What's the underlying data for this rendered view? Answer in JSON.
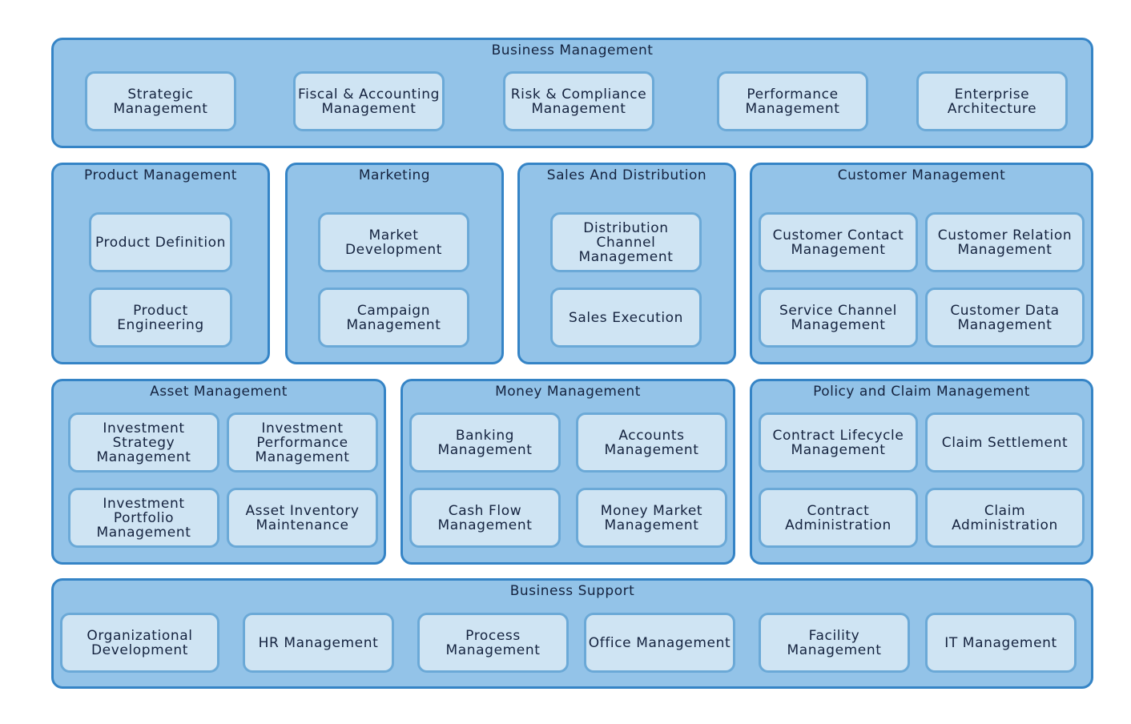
{
  "colors": {
    "group_fill": "#93c3e8",
    "group_border": "#3584c6",
    "capability_fill": "#cfe4f3",
    "capability_border": "#6ba9d7",
    "text": "#15233f"
  },
  "groups": [
    {
      "id": "business-management",
      "title": "Business Management",
      "capabilities": [
        "Strategic\nManagement",
        "Fiscal & Accounting\nManagement",
        "Risk & Compliance\nManagement",
        "Performance\nManagement",
        "Enterprise\nArchitecture"
      ]
    },
    {
      "id": "product-management",
      "title": "Product Management",
      "capabilities": [
        "Product Definition",
        "Product\nEngineering"
      ]
    },
    {
      "id": "marketing",
      "title": "Marketing",
      "capabilities": [
        "Market\nDevelopment",
        "Campaign\nManagement"
      ]
    },
    {
      "id": "sales-and-distribution",
      "title": "Sales And Distribution",
      "capabilities": [
        "Distribution\nChannel\nManagement",
        "Sales Execution"
      ]
    },
    {
      "id": "customer-management",
      "title": "Customer Management",
      "capabilities": [
        "Customer Contact\nManagement",
        "Customer Relation\nManagement",
        "Service Channel\nManagement",
        "Customer Data\nManagement"
      ]
    },
    {
      "id": "asset-management",
      "title": "Asset Management",
      "capabilities": [
        "Investment\nStrategy\nManagement",
        "Investment\nPerformance\nManagement",
        "Investment\nPortfolio\nManagement",
        "Asset Inventory\nMaintenance"
      ]
    },
    {
      "id": "money-management",
      "title": "Money Management",
      "capabilities": [
        "Banking\nManagement",
        "Accounts\nManagement",
        "Cash Flow\nManagement",
        "Money Market\nManagement"
      ]
    },
    {
      "id": "policy-and-claim-management",
      "title": "Policy and Claim Management",
      "capabilities": [
        "Contract Lifecycle\nManagement",
        "Claim Settlement",
        "Contract\nAdministration",
        "Claim\nAdministration"
      ]
    },
    {
      "id": "business-support",
      "title": "Business Support",
      "capabilities": [
        "Organizational\nDevelopment",
        "HR Management",
        "Process\nManagement",
        "Office Management",
        "Facility\nManagement",
        "IT Management"
      ]
    }
  ]
}
